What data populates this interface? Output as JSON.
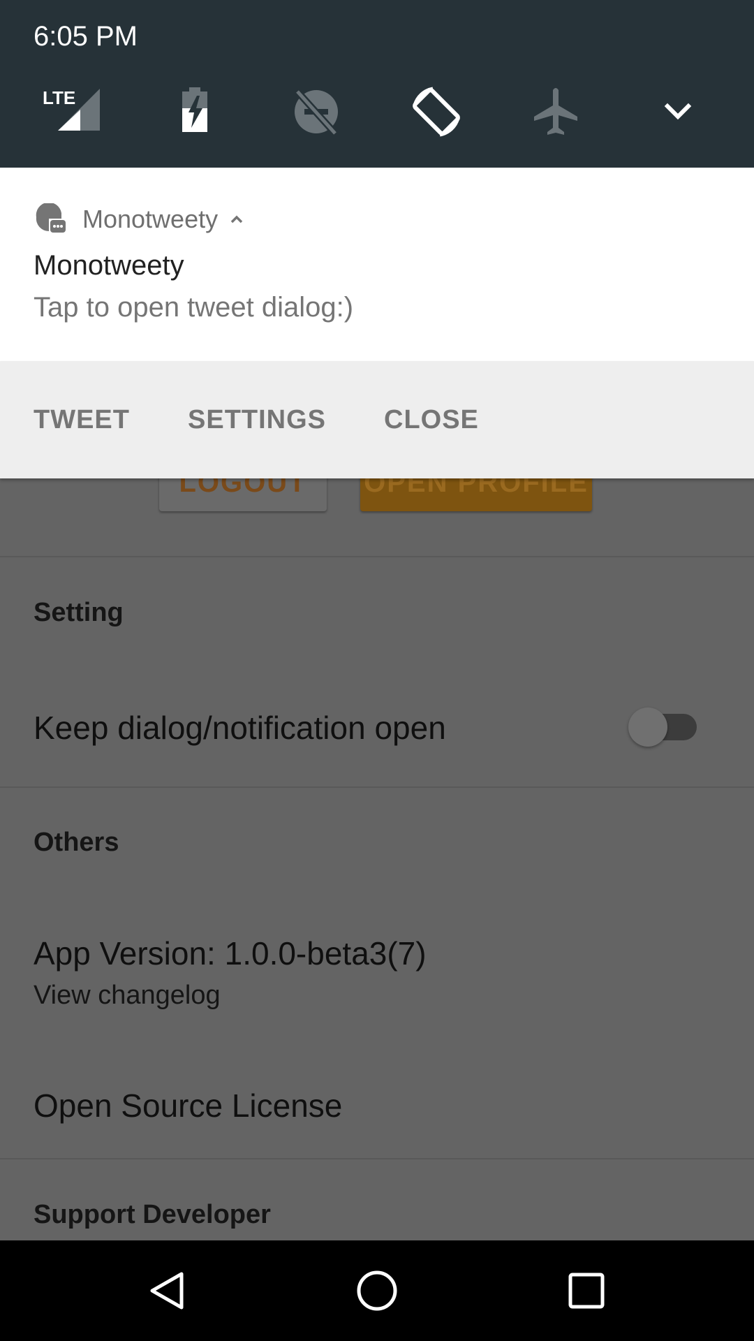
{
  "status_bar": {
    "time": "6:05 PM",
    "network_label": "LTE"
  },
  "quick_settings": {
    "tiles": [
      {
        "icon": "lte-signal-icon",
        "active": true
      },
      {
        "icon": "battery-charging-icon",
        "active": true
      },
      {
        "icon": "do-not-disturb-off-icon",
        "active": false
      },
      {
        "icon": "auto-rotate-icon",
        "active": true
      },
      {
        "icon": "airplane-mode-icon",
        "active": false
      },
      {
        "icon": "expand-chevron-icon",
        "active": true
      }
    ],
    "colors": {
      "background": "#263238",
      "active_icon": "#ffffff",
      "inactive_icon": "#6b7479"
    }
  },
  "notification": {
    "app_name": "Monotweety",
    "title": "Monotweety",
    "text": "Tap to open tweet dialog:)",
    "actions": [
      "TWEET",
      "SETTINGS",
      "CLOSE"
    ]
  },
  "app": {
    "buttons": {
      "logout": "LOGOUT",
      "open_profile": "OPEN PROFILE"
    },
    "sections": {
      "setting": "Setting",
      "others": "Others",
      "support": "Support Developer"
    },
    "prefs": {
      "keep_open": {
        "title": "Keep dialog/notification open",
        "enabled": false
      },
      "version": {
        "title": "App Version: 1.0.0-beta3(7)",
        "summary": "View changelog"
      },
      "license": {
        "title": "Open Source License"
      }
    },
    "colors": {
      "accent": "#FF9800",
      "scrim": "#646464"
    }
  },
  "nav_bar": {
    "buttons": [
      "back-icon",
      "home-icon",
      "recents-icon"
    ]
  }
}
